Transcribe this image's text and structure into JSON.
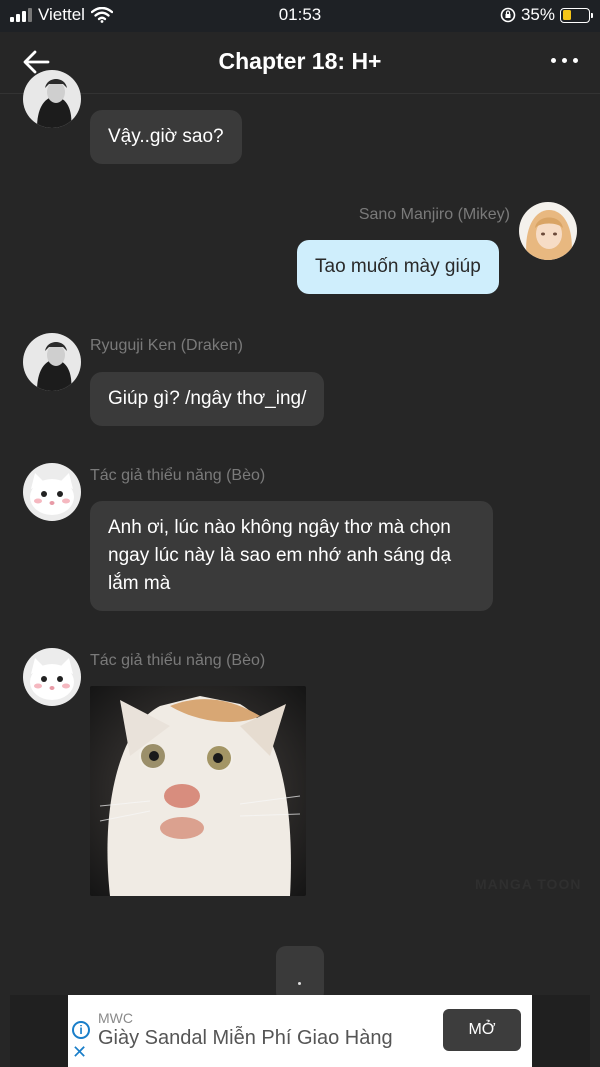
{
  "status": {
    "carrier": "Viettel",
    "time": "01:53",
    "battery": "35%",
    "battery_level": 0.35
  },
  "header": {
    "title": "Chapter 18: H+",
    "back_icon": "arrow-left-icon",
    "more_icon": "more-horizontal-icon"
  },
  "messages": [
    {
      "text": "Vậy..giờ sao?"
    },
    {
      "sender": "Sano Manjiro (Mikey)",
      "text": "Tao muốn mày giúp"
    },
    {
      "sender": "Ryuguji Ken (Draken)",
      "text": "Giúp gì? /ngây thơ_ing/"
    },
    {
      "sender": "Tác giả thiểu năng (Bèo)",
      "text": "Anh ơi, lúc nào không ngây thơ mà chọn ngay lúc này là sao em nhớ anh sáng dạ lắm mà"
    },
    {
      "sender": "Tác giả thiểu năng (Bèo)"
    }
  ],
  "watermark": "MANGA TOON",
  "typing_indicator": ".",
  "ad": {
    "brand": "MWC",
    "text": "Giày Sandal Miễn Phí Giao Hàng",
    "cta": "MỞ"
  },
  "colors": {
    "background": "#262626",
    "bubble_other": "#3a3a3a",
    "bubble_me": "#cfeefc",
    "battery": "#f5c518",
    "ad_icon": "#1a7ec9"
  }
}
